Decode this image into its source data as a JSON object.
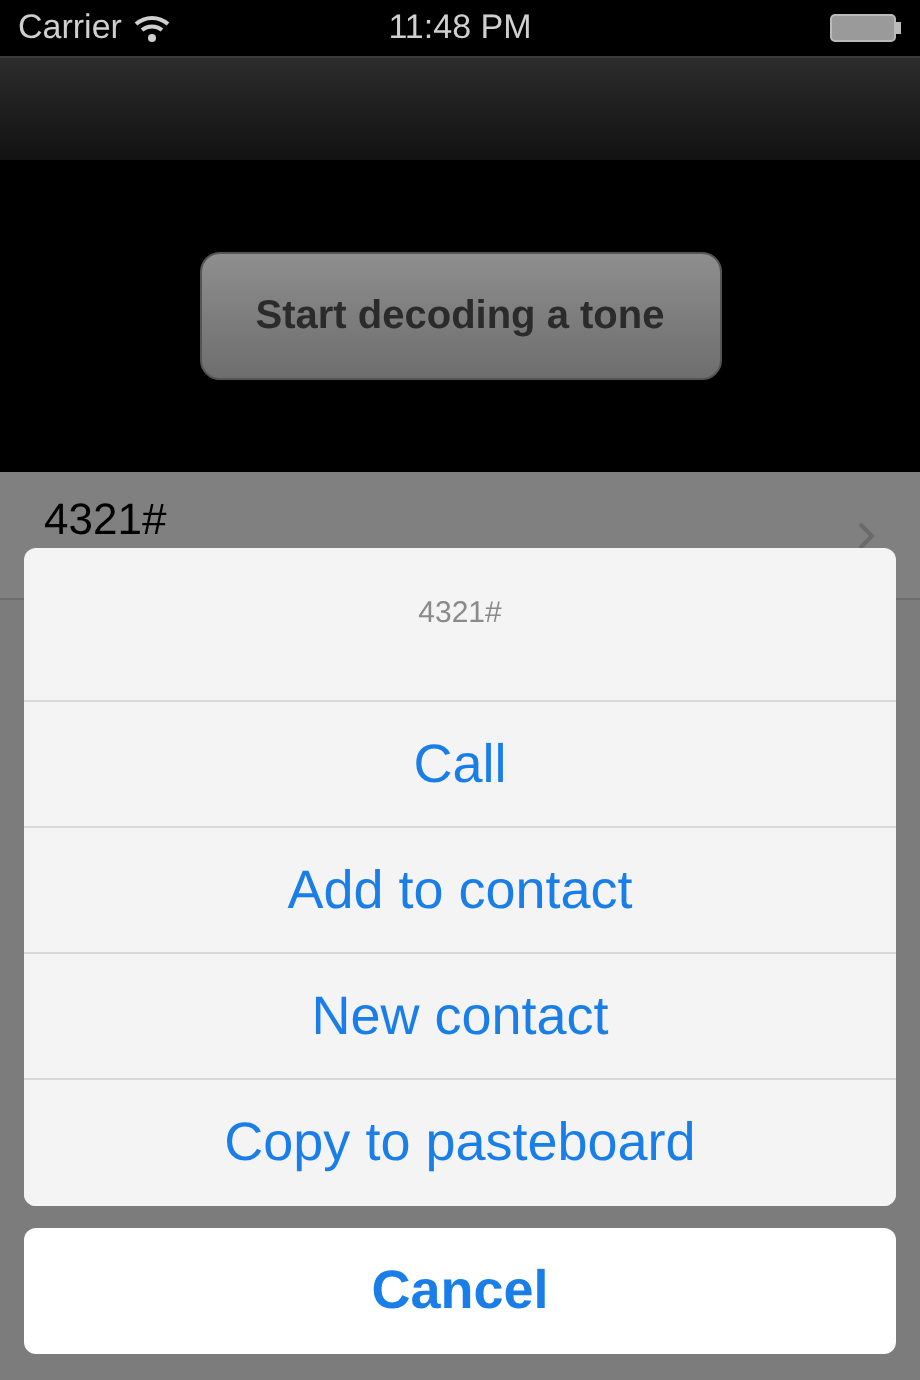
{
  "status_bar": {
    "carrier": "Carrier",
    "time": "11:48 PM"
  },
  "decode_button": {
    "label": "Start decoding a tone"
  },
  "table": {
    "rows": [
      {
        "title": "4321#"
      }
    ]
  },
  "action_sheet": {
    "title": "4321#",
    "actions": [
      {
        "label": "Call"
      },
      {
        "label": "Add to contact"
      },
      {
        "label": "New contact"
      },
      {
        "label": "Copy to pasteboard"
      }
    ],
    "cancel": {
      "label": "Cancel"
    }
  }
}
